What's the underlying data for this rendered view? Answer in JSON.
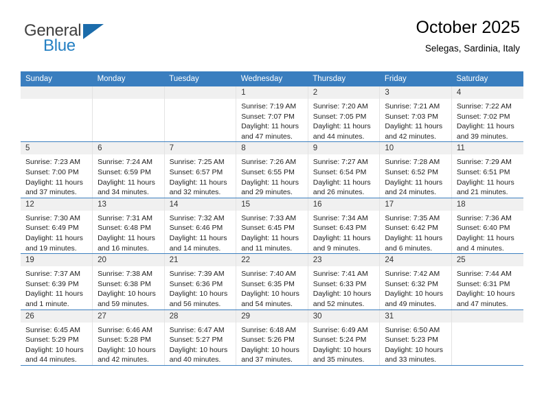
{
  "brand": {
    "name_top": "General",
    "name_bottom": "Blue",
    "triangle_color": "#1b6cab",
    "blue_color": "#2580c3",
    "gray_color": "#3f3f3f"
  },
  "header": {
    "title": "October 2025",
    "subtitle": "Selegas, Sardinia, Italy"
  },
  "theme": {
    "header_row_bg": "#3a7ebf",
    "header_row_text": "#ffffff",
    "daynum_band_bg": "#f0f0f0",
    "cell_border": "#e3e3e3",
    "week_separator": "#3a7ebf"
  },
  "weekdays": [
    "Sunday",
    "Monday",
    "Tuesday",
    "Wednesday",
    "Thursday",
    "Friday",
    "Saturday"
  ],
  "labels": {
    "sunrise_prefix": "Sunrise:",
    "sunset_prefix": "Sunset:",
    "daylight_prefix": "Daylight:"
  },
  "weeks": [
    [
      {
        "empty": true
      },
      {
        "empty": true
      },
      {
        "empty": true
      },
      {
        "day": "1",
        "sunrise": "Sunrise: 7:19 AM",
        "sunset": "Sunset: 7:07 PM",
        "daylight1": "Daylight: 11 hours",
        "daylight2": "and 47 minutes."
      },
      {
        "day": "2",
        "sunrise": "Sunrise: 7:20 AM",
        "sunset": "Sunset: 7:05 PM",
        "daylight1": "Daylight: 11 hours",
        "daylight2": "and 44 minutes."
      },
      {
        "day": "3",
        "sunrise": "Sunrise: 7:21 AM",
        "sunset": "Sunset: 7:03 PM",
        "daylight1": "Daylight: 11 hours",
        "daylight2": "and 42 minutes."
      },
      {
        "day": "4",
        "sunrise": "Sunrise: 7:22 AM",
        "sunset": "Sunset: 7:02 PM",
        "daylight1": "Daylight: 11 hours",
        "daylight2": "and 39 minutes."
      }
    ],
    [
      {
        "day": "5",
        "sunrise": "Sunrise: 7:23 AM",
        "sunset": "Sunset: 7:00 PM",
        "daylight1": "Daylight: 11 hours",
        "daylight2": "and 37 minutes."
      },
      {
        "day": "6",
        "sunrise": "Sunrise: 7:24 AM",
        "sunset": "Sunset: 6:59 PM",
        "daylight1": "Daylight: 11 hours",
        "daylight2": "and 34 minutes."
      },
      {
        "day": "7",
        "sunrise": "Sunrise: 7:25 AM",
        "sunset": "Sunset: 6:57 PM",
        "daylight1": "Daylight: 11 hours",
        "daylight2": "and 32 minutes."
      },
      {
        "day": "8",
        "sunrise": "Sunrise: 7:26 AM",
        "sunset": "Sunset: 6:55 PM",
        "daylight1": "Daylight: 11 hours",
        "daylight2": "and 29 minutes."
      },
      {
        "day": "9",
        "sunrise": "Sunrise: 7:27 AM",
        "sunset": "Sunset: 6:54 PM",
        "daylight1": "Daylight: 11 hours",
        "daylight2": "and 26 minutes."
      },
      {
        "day": "10",
        "sunrise": "Sunrise: 7:28 AM",
        "sunset": "Sunset: 6:52 PM",
        "daylight1": "Daylight: 11 hours",
        "daylight2": "and 24 minutes."
      },
      {
        "day": "11",
        "sunrise": "Sunrise: 7:29 AM",
        "sunset": "Sunset: 6:51 PM",
        "daylight1": "Daylight: 11 hours",
        "daylight2": "and 21 minutes."
      }
    ],
    [
      {
        "day": "12",
        "sunrise": "Sunrise: 7:30 AM",
        "sunset": "Sunset: 6:49 PM",
        "daylight1": "Daylight: 11 hours",
        "daylight2": "and 19 minutes."
      },
      {
        "day": "13",
        "sunrise": "Sunrise: 7:31 AM",
        "sunset": "Sunset: 6:48 PM",
        "daylight1": "Daylight: 11 hours",
        "daylight2": "and 16 minutes."
      },
      {
        "day": "14",
        "sunrise": "Sunrise: 7:32 AM",
        "sunset": "Sunset: 6:46 PM",
        "daylight1": "Daylight: 11 hours",
        "daylight2": "and 14 minutes."
      },
      {
        "day": "15",
        "sunrise": "Sunrise: 7:33 AM",
        "sunset": "Sunset: 6:45 PM",
        "daylight1": "Daylight: 11 hours",
        "daylight2": "and 11 minutes."
      },
      {
        "day": "16",
        "sunrise": "Sunrise: 7:34 AM",
        "sunset": "Sunset: 6:43 PM",
        "daylight1": "Daylight: 11 hours",
        "daylight2": "and 9 minutes."
      },
      {
        "day": "17",
        "sunrise": "Sunrise: 7:35 AM",
        "sunset": "Sunset: 6:42 PM",
        "daylight1": "Daylight: 11 hours",
        "daylight2": "and 6 minutes."
      },
      {
        "day": "18",
        "sunrise": "Sunrise: 7:36 AM",
        "sunset": "Sunset: 6:40 PM",
        "daylight1": "Daylight: 11 hours",
        "daylight2": "and 4 minutes."
      }
    ],
    [
      {
        "day": "19",
        "sunrise": "Sunrise: 7:37 AM",
        "sunset": "Sunset: 6:39 PM",
        "daylight1": "Daylight: 11 hours",
        "daylight2": "and 1 minute."
      },
      {
        "day": "20",
        "sunrise": "Sunrise: 7:38 AM",
        "sunset": "Sunset: 6:38 PM",
        "daylight1": "Daylight: 10 hours",
        "daylight2": "and 59 minutes."
      },
      {
        "day": "21",
        "sunrise": "Sunrise: 7:39 AM",
        "sunset": "Sunset: 6:36 PM",
        "daylight1": "Daylight: 10 hours",
        "daylight2": "and 56 minutes."
      },
      {
        "day": "22",
        "sunrise": "Sunrise: 7:40 AM",
        "sunset": "Sunset: 6:35 PM",
        "daylight1": "Daylight: 10 hours",
        "daylight2": "and 54 minutes."
      },
      {
        "day": "23",
        "sunrise": "Sunrise: 7:41 AM",
        "sunset": "Sunset: 6:33 PM",
        "daylight1": "Daylight: 10 hours",
        "daylight2": "and 52 minutes."
      },
      {
        "day": "24",
        "sunrise": "Sunrise: 7:42 AM",
        "sunset": "Sunset: 6:32 PM",
        "daylight1": "Daylight: 10 hours",
        "daylight2": "and 49 minutes."
      },
      {
        "day": "25",
        "sunrise": "Sunrise: 7:44 AM",
        "sunset": "Sunset: 6:31 PM",
        "daylight1": "Daylight: 10 hours",
        "daylight2": "and 47 minutes."
      }
    ],
    [
      {
        "day": "26",
        "sunrise": "Sunrise: 6:45 AM",
        "sunset": "Sunset: 5:29 PM",
        "daylight1": "Daylight: 10 hours",
        "daylight2": "and 44 minutes."
      },
      {
        "day": "27",
        "sunrise": "Sunrise: 6:46 AM",
        "sunset": "Sunset: 5:28 PM",
        "daylight1": "Daylight: 10 hours",
        "daylight2": "and 42 minutes."
      },
      {
        "day": "28",
        "sunrise": "Sunrise: 6:47 AM",
        "sunset": "Sunset: 5:27 PM",
        "daylight1": "Daylight: 10 hours",
        "daylight2": "and 40 minutes."
      },
      {
        "day": "29",
        "sunrise": "Sunrise: 6:48 AM",
        "sunset": "Sunset: 5:26 PM",
        "daylight1": "Daylight: 10 hours",
        "daylight2": "and 37 minutes."
      },
      {
        "day": "30",
        "sunrise": "Sunrise: 6:49 AM",
        "sunset": "Sunset: 5:24 PM",
        "daylight1": "Daylight: 10 hours",
        "daylight2": "and 35 minutes."
      },
      {
        "day": "31",
        "sunrise": "Sunrise: 6:50 AM",
        "sunset": "Sunset: 5:23 PM",
        "daylight1": "Daylight: 10 hours",
        "daylight2": "and 33 minutes."
      },
      {
        "empty": true
      }
    ]
  ]
}
